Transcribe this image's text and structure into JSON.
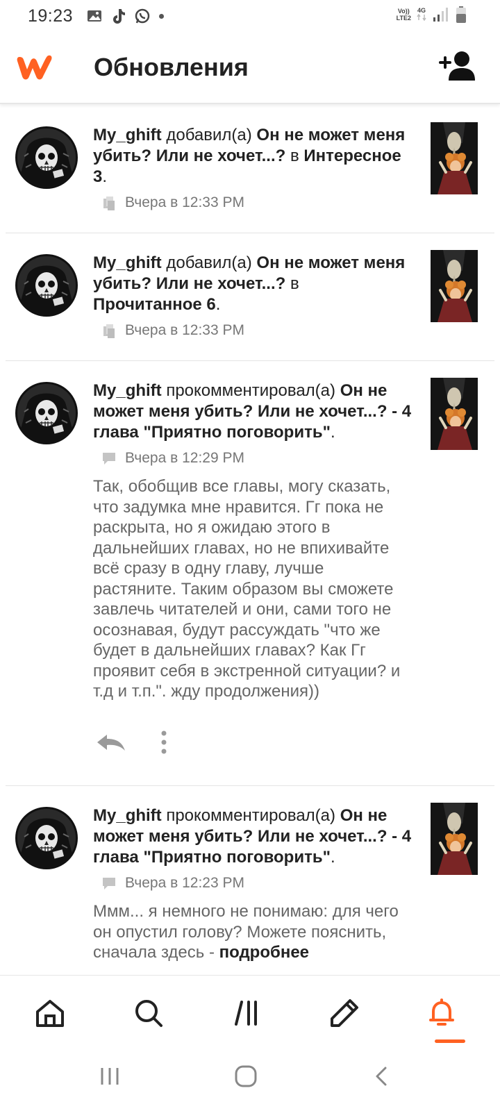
{
  "status_bar": {
    "time": "19:23",
    "network_top": "Vo))",
    "network_bottom": "LTE2",
    "signal_label": "4G"
  },
  "header": {
    "title": "Обновления"
  },
  "colors": {
    "accent": "#ff6122",
    "text": "#222222",
    "muted": "#777777"
  },
  "feed": [
    {
      "user": "My_ghift",
      "action": " добавил(а) ",
      "story": "Он не может меня убить? Или не хочет...?",
      "connector": " в ",
      "target": "Интересное 3",
      "end": ".",
      "time": "Вчера в 12:33 PM",
      "icon": "reading-list-icon"
    },
    {
      "user": "My_ghift",
      "action": " добавил(а) ",
      "story": "Он не может меня убить? Или не хочет...?",
      "connector": " в ",
      "target": "Прочитанное 6",
      "end": ".",
      "time": "Вчера в 12:33 PM",
      "icon": "reading-list-icon"
    },
    {
      "user": "My_ghift",
      "action": " прокомментировал(а) ",
      "story": "Он не может меня убить? Или не хочет...? - 4 глава \"Приятно поговорить\"",
      "end": ".",
      "time": "Вчера в 12:29 PM",
      "icon": "comment-icon",
      "comment": "Так, обобщив все главы, могу сказать, что задумка мне нравится. Гг пока не раскрыта, но я ожидаю этого в дальнейших главах, но не впихивайте всё сразу в одну главу, лучше растяните. Таким образом вы сможете завлечь читателей и они, сами того не осознавая, будут рассуждать \"что же будет в дальнейших главах? Как Гг проявит себя в экстренной ситуации? и т.д и т.п.\".  жду продолжения))"
    },
    {
      "user": "My_ghift",
      "action": " прокомментировал(а) ",
      "story": "Он не может меня убить? Или не хочет...? - 4 глава \"Приятно поговорить\"",
      "end": ".",
      "time": "Вчера в 12:23 PM",
      "icon": "comment-icon",
      "comment_prefix": "Ммм... я немного не понимаю: для чего он опустил голову? Можете пояснить, сначала здесь - ",
      "comment_bold": "подробнее"
    }
  ],
  "bottom_nav": [
    "home-icon",
    "search-icon",
    "library-icon",
    "write-icon",
    "notifications-icon"
  ],
  "system_nav": [
    "recents-icon",
    "home-button-icon",
    "back-icon"
  ]
}
